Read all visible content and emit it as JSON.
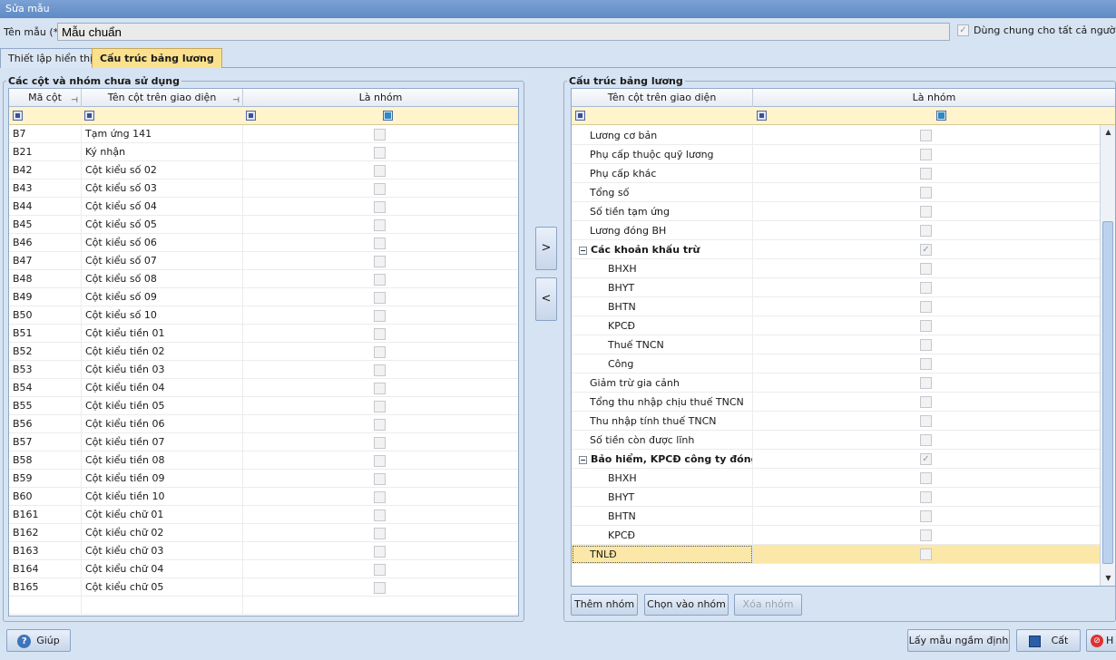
{
  "window": {
    "title": "Sửa mẫu"
  },
  "form": {
    "name_label": "Tên mẫu (*)",
    "name_value": "Mẫu chuẩn",
    "share_label": "Dùng chung cho tất cả  người dù",
    "share_checked": true
  },
  "tabs": [
    {
      "label": "Thiết lập hiển thị",
      "active": false
    },
    {
      "label": "Cấu trúc bảng lương",
      "active": true
    }
  ],
  "left_panel": {
    "title": "Các cột và nhóm chưa sử dụng",
    "headers": {
      "code": "Mã cột",
      "name": "Tên cột trên giao diện",
      "is_group": "Là nhóm"
    },
    "rows": [
      {
        "code": "B7",
        "name": "Tạm ứng 141",
        "is_group": false
      },
      {
        "code": "B21",
        "name": "Ký nhận",
        "is_group": false
      },
      {
        "code": "B42",
        "name": "Cột kiểu số 02",
        "is_group": false
      },
      {
        "code": "B43",
        "name": "Cột kiểu số 03",
        "is_group": false
      },
      {
        "code": "B44",
        "name": "Cột kiểu số 04",
        "is_group": false
      },
      {
        "code": "B45",
        "name": "Cột kiểu số 05",
        "is_group": false
      },
      {
        "code": "B46",
        "name": "Cột kiểu số 06",
        "is_group": false
      },
      {
        "code": "B47",
        "name": "Cột kiểu số 07",
        "is_group": false
      },
      {
        "code": "B48",
        "name": "Cột kiểu số 08",
        "is_group": false
      },
      {
        "code": "B49",
        "name": "Cột kiểu số 09",
        "is_group": false
      },
      {
        "code": "B50",
        "name": "Cột kiểu số 10",
        "is_group": false
      },
      {
        "code": "B51",
        "name": "Cột kiểu tiền 01",
        "is_group": false
      },
      {
        "code": "B52",
        "name": "Cột kiểu tiền 02",
        "is_group": false
      },
      {
        "code": "B53",
        "name": "Cột kiểu tiền 03",
        "is_group": false
      },
      {
        "code": "B54",
        "name": "Cột kiểu tiền 04",
        "is_group": false
      },
      {
        "code": "B55",
        "name": "Cột kiểu tiền 05",
        "is_group": false
      },
      {
        "code": "B56",
        "name": "Cột kiểu tiền 06",
        "is_group": false
      },
      {
        "code": "B57",
        "name": "Cột kiểu tiền 07",
        "is_group": false
      },
      {
        "code": "B58",
        "name": "Cột kiểu tiền 08",
        "is_group": false
      },
      {
        "code": "B59",
        "name": "Cột kiểu tiền 09",
        "is_group": false
      },
      {
        "code": "B60",
        "name": "Cột kiểu tiền 10",
        "is_group": false
      },
      {
        "code": "B161",
        "name": "Cột kiểu chữ 01",
        "is_group": false
      },
      {
        "code": "B162",
        "name": "Cột kiểu chữ 02",
        "is_group": false
      },
      {
        "code": "B163",
        "name": "Cột kiểu chữ 03",
        "is_group": false
      },
      {
        "code": "B164",
        "name": "Cột kiểu chữ 04",
        "is_group": false
      },
      {
        "code": "B165",
        "name": "Cột kiểu chữ 05",
        "is_group": false
      }
    ]
  },
  "transfer": {
    "move_right": ">",
    "move_left": "<"
  },
  "right_panel": {
    "title": "Cấu trúc bảng lương",
    "headers": {
      "name": "Tên cột trên giao diện",
      "is_group": "Là nhóm"
    },
    "rows": [
      {
        "name": "Lương cơ bản",
        "level": 1,
        "is_group": false
      },
      {
        "name": "Phụ cấp thuộc quỹ lương",
        "level": 1,
        "is_group": false
      },
      {
        "name": "Phụ cấp khác",
        "level": 1,
        "is_group": false
      },
      {
        "name": "Tổng số",
        "level": 1,
        "is_group": false
      },
      {
        "name": "Số tiền tạm ứng",
        "level": 1,
        "is_group": false
      },
      {
        "name": "Lương đóng BH",
        "level": 1,
        "is_group": false
      },
      {
        "name": "Các khoản khấu trừ",
        "level": 0,
        "is_group": true,
        "expander": "−"
      },
      {
        "name": "BHXH",
        "level": 2,
        "is_group": false
      },
      {
        "name": "BHYT",
        "level": 2,
        "is_group": false
      },
      {
        "name": "BHTN",
        "level": 2,
        "is_group": false
      },
      {
        "name": "KPCĐ",
        "level": 2,
        "is_group": false
      },
      {
        "name": "Thuế TNCN",
        "level": 2,
        "is_group": false
      },
      {
        "name": "Công",
        "level": 2,
        "is_group": false
      },
      {
        "name": "Giảm trừ gia cảnh",
        "level": 1,
        "is_group": false
      },
      {
        "name": "Tổng thu nhập chịu thuế TNCN",
        "level": 1,
        "is_group": false
      },
      {
        "name": "Thu nhập tính thuế TNCN",
        "level": 1,
        "is_group": false
      },
      {
        "name": "Số tiền còn được lĩnh",
        "level": 1,
        "is_group": false
      },
      {
        "name": "Bảo hiểm, KPCĐ công ty đóng",
        "level": 0,
        "is_group": true,
        "expander": "−"
      },
      {
        "name": "BHXH",
        "level": 2,
        "is_group": false
      },
      {
        "name": "BHYT",
        "level": 2,
        "is_group": false
      },
      {
        "name": "BHTN",
        "level": 2,
        "is_group": false
      },
      {
        "name": "KPCĐ",
        "level": 2,
        "is_group": false
      },
      {
        "name": "TNLĐ",
        "level": 1,
        "is_group": false,
        "selected": true
      }
    ],
    "buttons": {
      "add_group": "Thêm nhóm",
      "pick_group": "Chọn vào nhóm",
      "delete_group": "Xóa nhóm"
    }
  },
  "footer": {
    "help": "Giúp",
    "default_template": "Lấy mẫu ngầm định",
    "save": "Cất",
    "cancel": "H"
  },
  "icons": {
    "help": "help-icon",
    "save": "floppy-icon",
    "cancel": "cancel-icon",
    "pin": "pin-icon",
    "filter": "filter-icon"
  },
  "colors": {
    "title_bar": "#6b94cc",
    "active_tab": "#fbe18d",
    "filter_row": "#fff4cc",
    "selected_row": "#fbe7a7"
  }
}
